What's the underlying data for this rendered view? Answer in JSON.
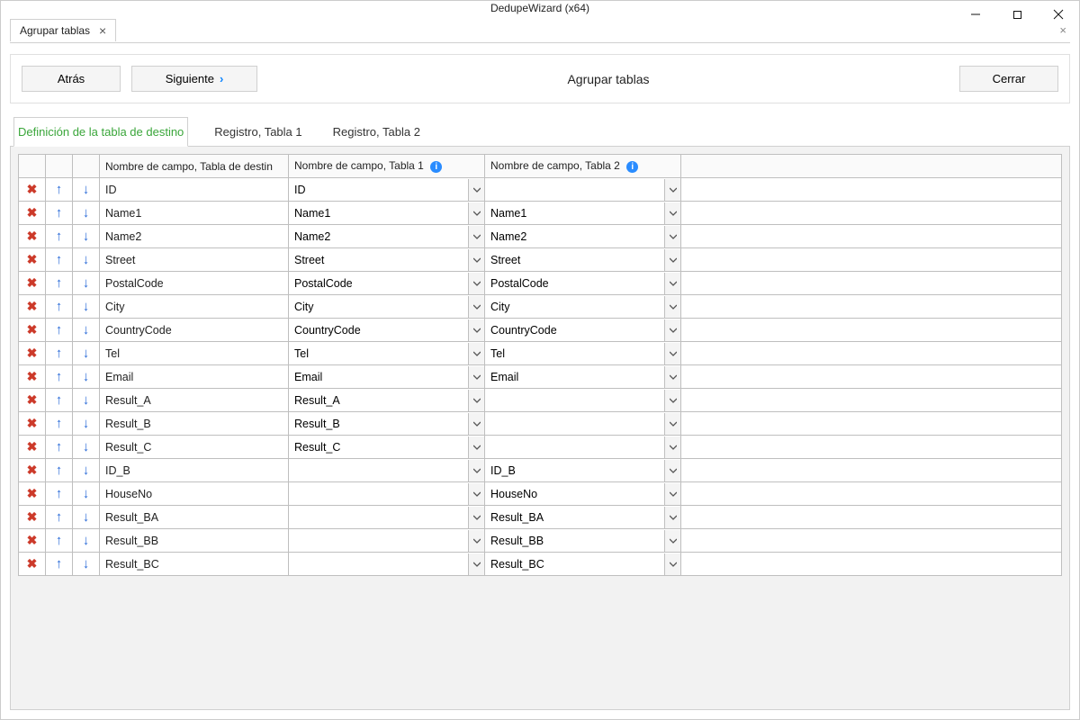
{
  "titlebar": {
    "title": "DedupeWizard  (x64)"
  },
  "outerTab": {
    "label": "Agrupar tablas"
  },
  "toolbar": {
    "back": "Atrás",
    "next": "Siguiente",
    "title": "Agrupar tablas",
    "close": "Cerrar"
  },
  "subTabs": {
    "t0": "Definición de la tabla de destino",
    "t1": "Registro, Tabla 1",
    "t2": "Registro, Tabla 2"
  },
  "headers": {
    "dest": "Nombre de campo, Tabla de destin",
    "t1": "Nombre de campo, Tabla 1",
    "t2": "Nombre de campo, Tabla 2"
  },
  "rows": [
    {
      "dest": "ID",
      "t1": "ID",
      "t2": ""
    },
    {
      "dest": "Name1",
      "t1": "Name1",
      "t2": "Name1"
    },
    {
      "dest": "Name2",
      "t1": "Name2",
      "t2": "Name2"
    },
    {
      "dest": "Street",
      "t1": "Street",
      "t2": "Street"
    },
    {
      "dest": "PostalCode",
      "t1": "PostalCode",
      "t2": "PostalCode"
    },
    {
      "dest": "City",
      "t1": "City",
      "t2": "City"
    },
    {
      "dest": "CountryCode",
      "t1": "CountryCode",
      "t2": "CountryCode"
    },
    {
      "dest": "Tel",
      "t1": "Tel",
      "t2": "Tel"
    },
    {
      "dest": "Email",
      "t1": "Email",
      "t2": "Email"
    },
    {
      "dest": "Result_A",
      "t1": "Result_A",
      "t2": ""
    },
    {
      "dest": "Result_B",
      "t1": "Result_B",
      "t2": ""
    },
    {
      "dest": "Result_C",
      "t1": "Result_C",
      "t2": ""
    },
    {
      "dest": "ID_B",
      "t1": "",
      "t2": "ID_B"
    },
    {
      "dest": "HouseNo",
      "t1": "",
      "t2": "HouseNo"
    },
    {
      "dest": "Result_BA",
      "t1": "",
      "t2": "Result_BA"
    },
    {
      "dest": "Result_BB",
      "t1": "",
      "t2": "Result_BB"
    },
    {
      "dest": "Result_BC",
      "t1": "",
      "t2": "Result_BC"
    }
  ]
}
